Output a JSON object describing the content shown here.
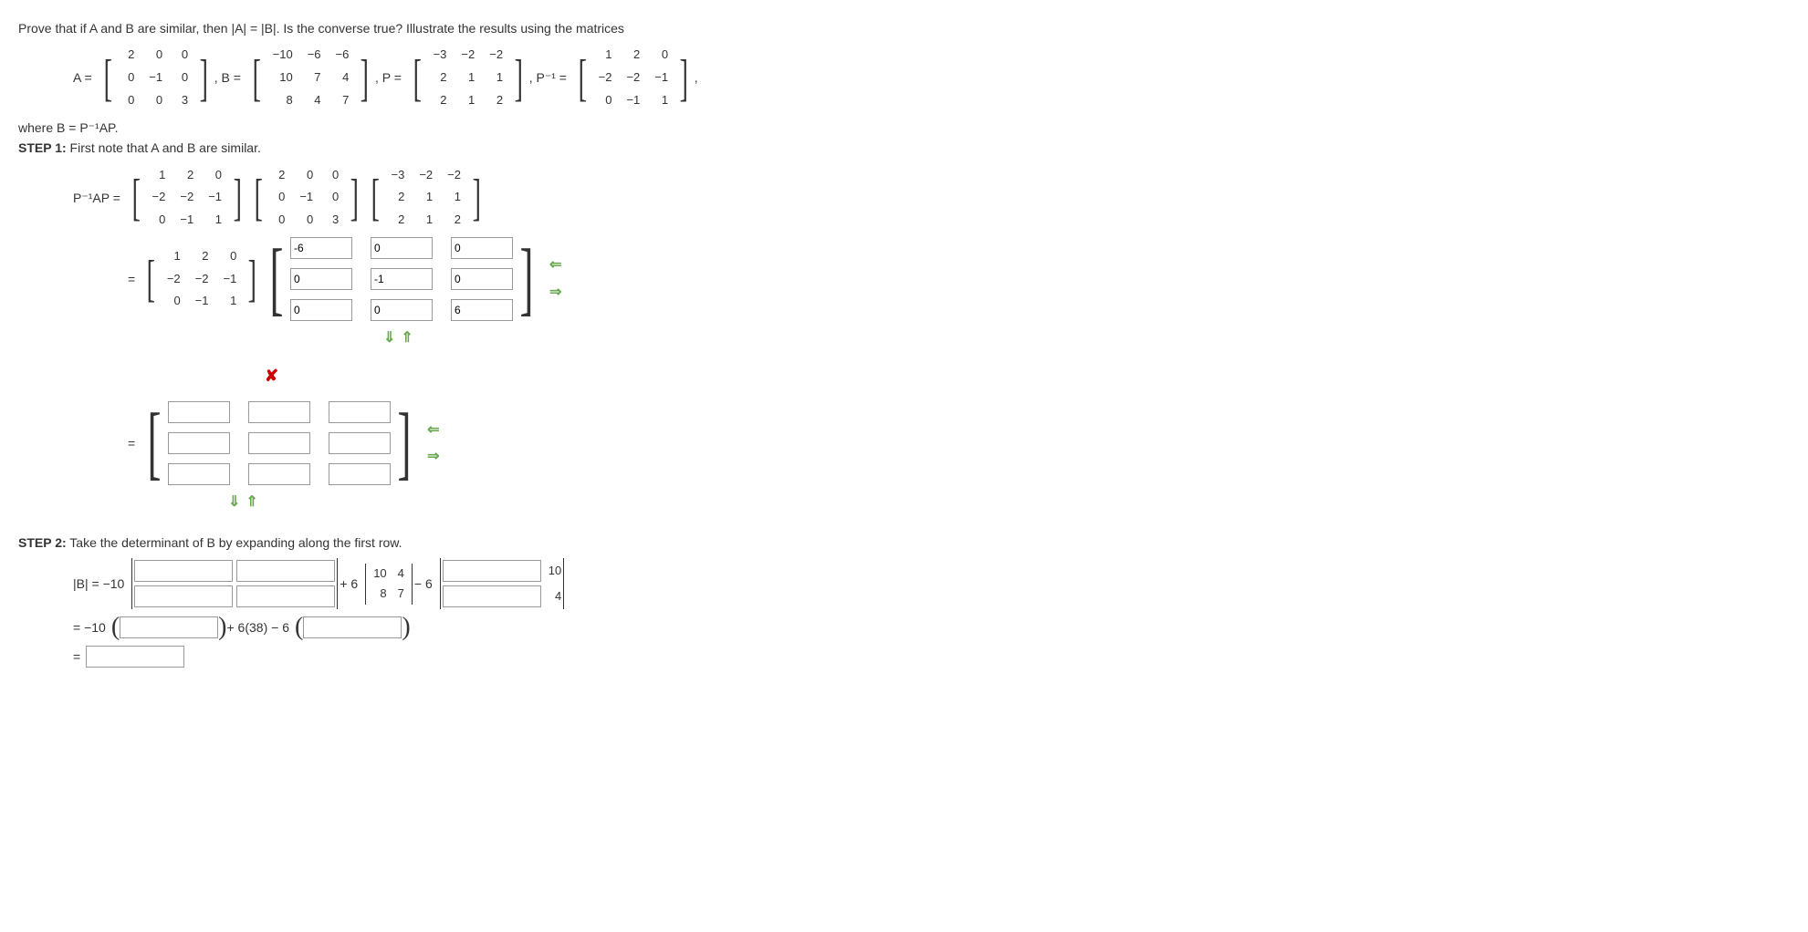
{
  "problem_text": "Prove that if A and B are similar, then |A| = |B|. Is the converse true? Illustrate the results using the matrices",
  "where_text": "where B = P⁻¹AP.",
  "step1_label": "STEP 1:",
  "step1_text": " First note that A and B are similar.",
  "step2_label": "STEP 2:",
  "step2_text": " Take the determinant of B by expanding along the first row.",
  "A_label": "A = ",
  "B_label": ", B = ",
  "P_label": ", P = ",
  "Pinv_label": ", P⁻¹ = ",
  "comma": ",",
  "PinvAP_label": "P⁻¹AP = ",
  "equals": "= ",
  "detB_label": "|B| = −10",
  "plus6": " + 6",
  "minus6": " − 6",
  "eq_neg10": "= −10",
  "plus638": " + 6(38) − 6",
  "final_eq": "= ",
  "matrices": {
    "A": [
      [
        "2",
        "0",
        "0"
      ],
      [
        "0",
        "−1",
        "0"
      ],
      [
        "0",
        "0",
        "3"
      ]
    ],
    "B": [
      [
        "−10",
        "−6",
        "−6"
      ],
      [
        "10",
        "7",
        "4"
      ],
      [
        "8",
        "4",
        "7"
      ]
    ],
    "P": [
      [
        "−3",
        "−2",
        "−2"
      ],
      [
        "2",
        "1",
        "1"
      ],
      [
        "2",
        "1",
        "2"
      ]
    ],
    "Pinv": [
      [
        "1",
        "2",
        "0"
      ],
      [
        "−2",
        "−2",
        "−1"
      ],
      [
        "0",
        "−1",
        "1"
      ]
    ]
  },
  "step1_inputs": {
    "r1": [
      "-6",
      "0",
      "0"
    ],
    "r2": [
      "0",
      "-1",
      "0"
    ],
    "r3": [
      "0",
      "0",
      "6"
    ]
  },
  "det_mid": {
    "r1": [
      "10",
      "4"
    ],
    "r2": [
      "8",
      "7"
    ]
  },
  "det_right_tr": "10",
  "det_right_br": "4",
  "chart_data": null
}
